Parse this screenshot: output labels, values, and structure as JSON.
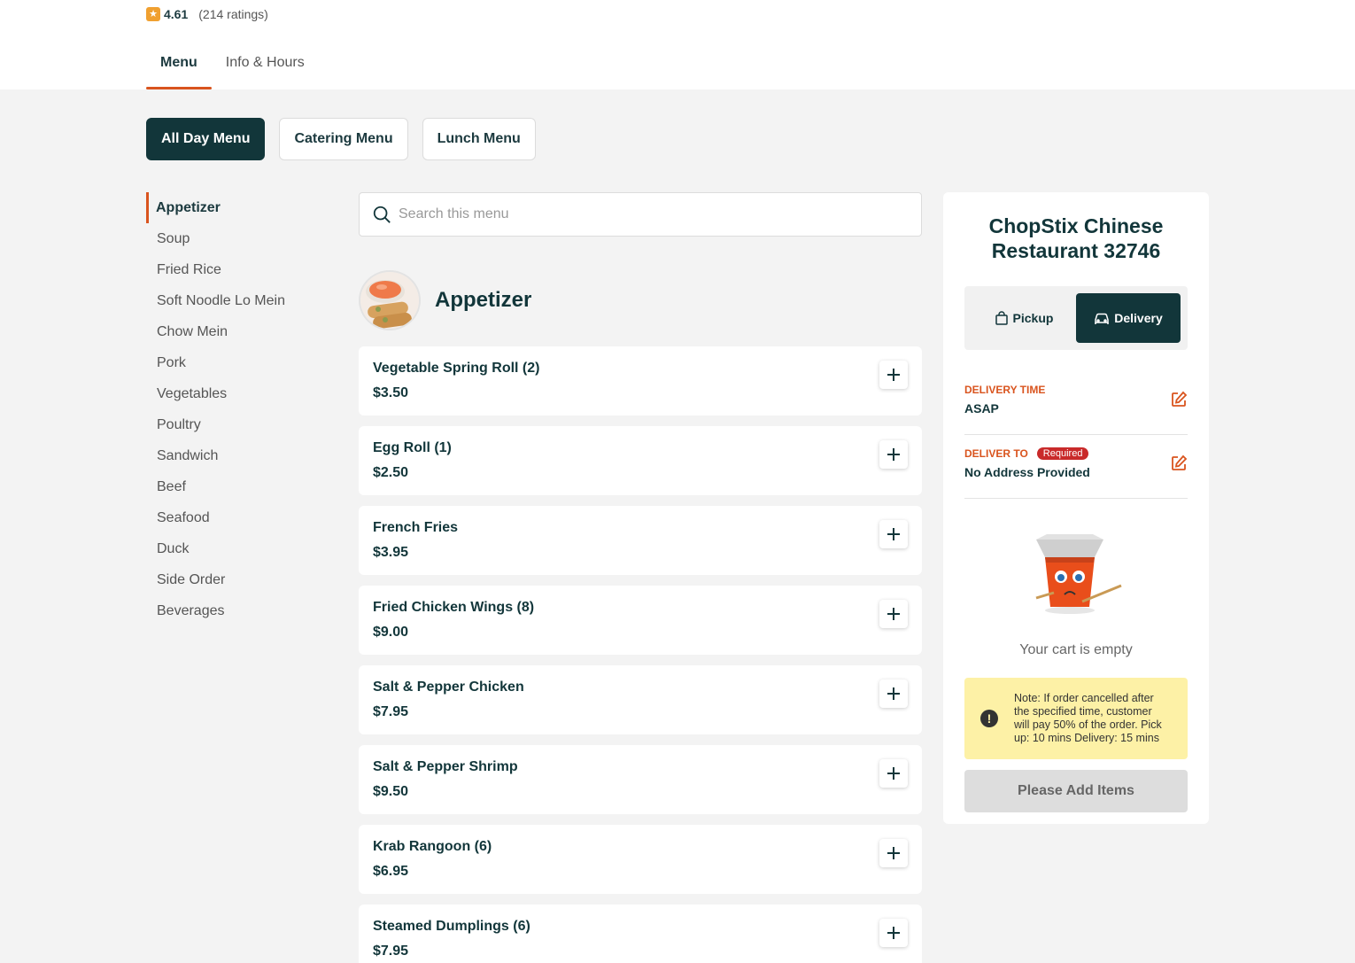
{
  "header": {
    "rating_score": "4.61",
    "rating_count": "(214 ratings)",
    "tabs": [
      {
        "label": "Menu"
      },
      {
        "label": "Info & Hours"
      }
    ]
  },
  "menus": [
    {
      "label": "All Day Menu",
      "active": true
    },
    {
      "label": "Catering Menu",
      "active": false
    },
    {
      "label": "Lunch Menu",
      "active": false
    }
  ],
  "categories": [
    "Appetizer",
    "Soup",
    "Fried Rice",
    "Soft Noodle Lo Mein",
    "Chow Mein",
    "Pork",
    "Vegetables",
    "Poultry",
    "Sandwich",
    "Beef",
    "Seafood",
    "Duck",
    "Side Order",
    "Beverages"
  ],
  "search": {
    "placeholder": "Search this menu"
  },
  "section": {
    "title": "Appetizer"
  },
  "items": [
    {
      "name": "Vegetable Spring Roll (2)",
      "price": "$3.50"
    },
    {
      "name": "Egg Roll (1)",
      "price": "$2.50"
    },
    {
      "name": "French Fries",
      "price": "$3.95"
    },
    {
      "name": "Fried Chicken Wings (8)",
      "price": "$9.00"
    },
    {
      "name": "Salt & Pepper Chicken",
      "price": "$7.95"
    },
    {
      "name": "Salt & Pepper Shrimp",
      "price": "$9.50"
    },
    {
      "name": "Krab Rangoon (6)",
      "price": "$6.95"
    },
    {
      "name": "Steamed Dumplings (6)",
      "price": "$7.95"
    }
  ],
  "cart": {
    "restaurant_name": "ChopStix Chinese Restaurant 32746",
    "modes": {
      "pickup": "Pickup",
      "delivery": "Delivery"
    },
    "delivery_time_label": "DELIVERY TIME",
    "delivery_time_value": "ASAP",
    "deliver_to_label": "DELIVER TO",
    "required_badge": "Required",
    "deliver_to_value": "No Address Provided",
    "empty_text": "Your cart is empty",
    "note": "Note: If order cancelled after the specified time, customer will pay 50% of the order. Pick up: 10 mins Delivery: 15 mins",
    "checkout_label": "Please Add Items"
  },
  "colors": {
    "accent": "#d9541e",
    "primary_dark": "#12363a",
    "note_bg": "#fdf1a6",
    "required_red": "#c92a2a"
  }
}
